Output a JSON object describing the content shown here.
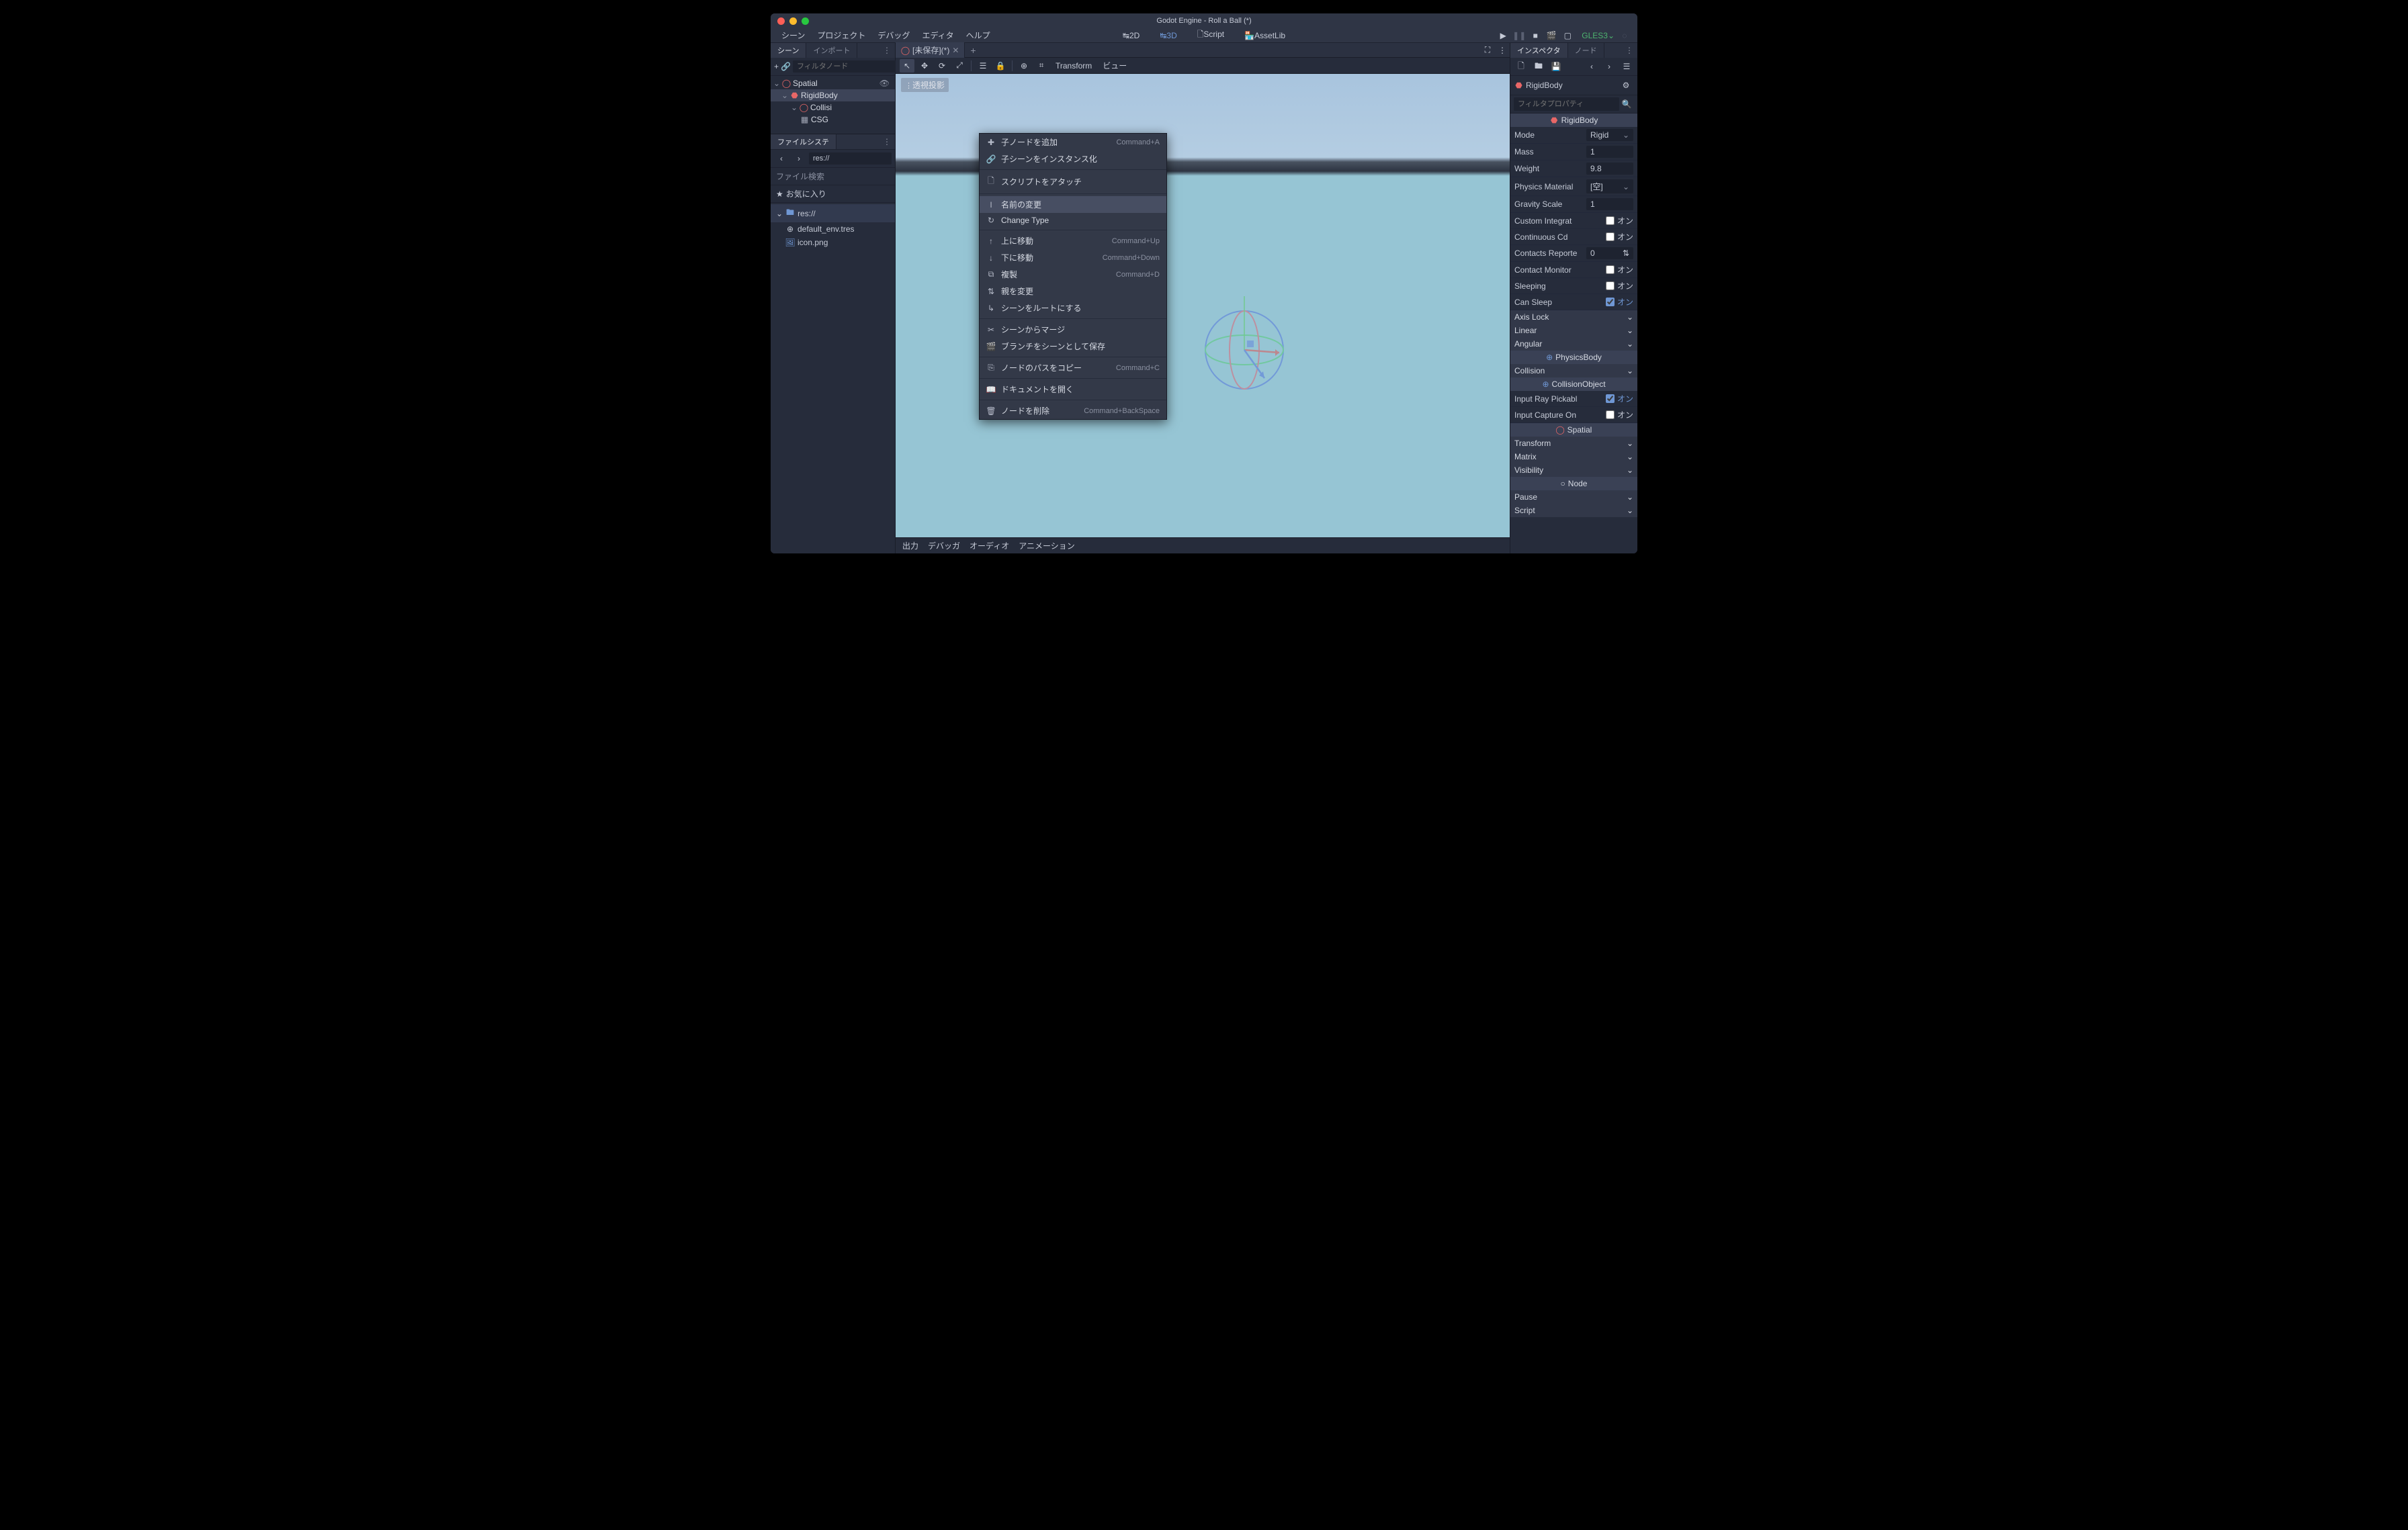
{
  "titlebar": {
    "title": "Godot Engine - Roll a Ball (*)"
  },
  "menubar": {
    "scene": "シーン",
    "project": "プロジェクト",
    "debug": "デバッグ",
    "editor": "エディタ",
    "help": "ヘルプ",
    "mode2d": "2D",
    "mode3d": "3D",
    "script": "Script",
    "assetlib": "AssetLib",
    "gles": "GLES3"
  },
  "left": {
    "tab_scene": "シーン",
    "tab_import": "インポート",
    "filter_placeholder": "フィルタノード",
    "tree": {
      "spatial": "Spatial",
      "rigidbody": "RigidBody",
      "collision": "Collisi",
      "csg": "CSG"
    },
    "fs": {
      "header": "ファイルシステ",
      "path": "res://",
      "search_label": "ファイル検索",
      "fav_label": "お気に入り",
      "folder": "res://",
      "file1": "default_env.tres",
      "file2": "icon.png"
    }
  },
  "center": {
    "tab_name": "[未保存](*)",
    "transform": "Transform",
    "view": "ビュー",
    "projection": "透視投影",
    "bottom": {
      "output": "出力",
      "debugger": "デバッガ",
      "audio": "オーディオ",
      "animation": "アニメーション"
    }
  },
  "context_menu": {
    "add_child": "子ノードを追加",
    "add_child_sc": "Command+A",
    "instance": "子シーンをインスタンス化",
    "attach_script": "スクリプトをアタッチ",
    "rename": "名前の変更",
    "change_type": "Change Type",
    "move_up": "上に移動",
    "move_up_sc": "Command+Up",
    "move_down": "下に移動",
    "move_down_sc": "Command+Down",
    "duplicate": "複製",
    "duplicate_sc": "Command+D",
    "reparent": "親を変更",
    "make_root": "シーンをルートにする",
    "merge": "シーンからマージ",
    "save_branch": "ブランチをシーンとして保存",
    "copy_path": "ノードのパスをコピー",
    "copy_path_sc": "Command+C",
    "open_docs": "ドキュメントを開く",
    "delete": "ノードを削除",
    "delete_sc": "Command+BackSpace"
  },
  "right": {
    "tab_inspector": "インスペクタ",
    "tab_node": "ノード",
    "object": "RigidBody",
    "filter_placeholder": "フィルタプロパティ",
    "section_rigidbody": "RigidBody",
    "section_physicsbody": "PhysicsBody",
    "section_collisionobject": "CollisionObject",
    "section_spatial": "Spatial",
    "section_node": "Node",
    "props": {
      "mode": {
        "label": "Mode",
        "value": "Rigid"
      },
      "mass": {
        "label": "Mass",
        "value": "1"
      },
      "weight": {
        "label": "Weight",
        "value": "9.8"
      },
      "phys_mat": {
        "label": "Physics Material",
        "value": "[空]"
      },
      "gravity": {
        "label": "Gravity Scale",
        "value": "1"
      },
      "custom_int": {
        "label": "Custom Integrat",
        "value": "オン"
      },
      "cont_cd": {
        "label": "Continuous Cd",
        "value": "オン"
      },
      "contacts": {
        "label": "Contacts Reporte",
        "value": "0"
      },
      "contact_mon": {
        "label": "Contact Monitor",
        "value": "オン"
      },
      "sleeping": {
        "label": "Sleeping",
        "value": "オン"
      },
      "can_sleep": {
        "label": "Can Sleep",
        "value": "オン"
      },
      "axis_lock": {
        "label": "Axis Lock"
      },
      "linear": {
        "label": "Linear"
      },
      "angular": {
        "label": "Angular"
      },
      "collision": {
        "label": "Collision"
      },
      "input_ray": {
        "label": "Input Ray Pickabl",
        "value": "オン"
      },
      "input_cap": {
        "label": "Input Capture On",
        "value": "オン"
      },
      "transform": {
        "label": "Transform"
      },
      "matrix": {
        "label": "Matrix"
      },
      "visibility": {
        "label": "Visibility"
      },
      "pause": {
        "label": "Pause"
      },
      "script": {
        "label": "Script"
      }
    }
  }
}
